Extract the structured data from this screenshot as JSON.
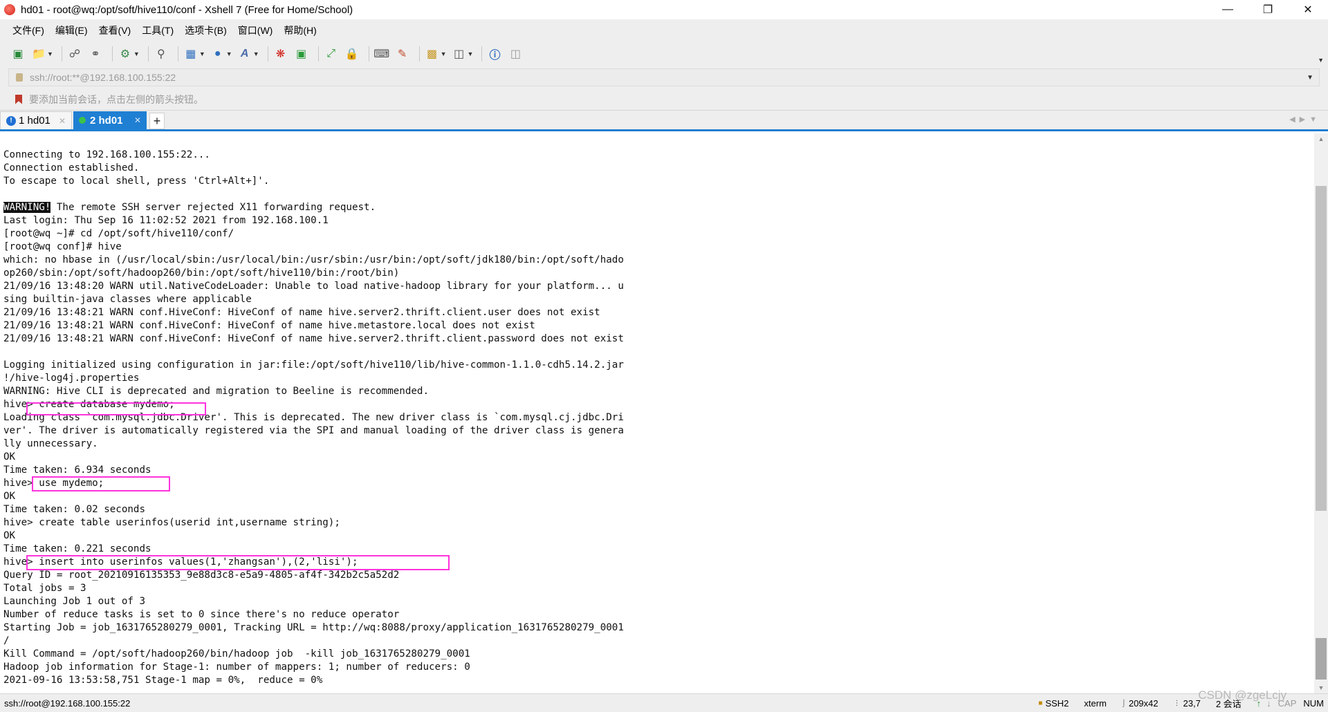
{
  "window": {
    "title": "hd01 - root@wq:/opt/soft/hive110/conf - Xshell 7 (Free for Home/School)",
    "minimize_icon": "minimize-icon",
    "maximize_icon": "restore-icon",
    "close_icon": "close-icon"
  },
  "menu": [
    "文件(F)",
    "编辑(E)",
    "查看(V)",
    "工具(T)",
    "选项卡(B)",
    "窗口(W)",
    "帮助(H)"
  ],
  "address": {
    "value": "ssh://root:**@192.168.100.155:22"
  },
  "hint": {
    "text": "要添加当前会话，点击左侧的箭头按钮。"
  },
  "tabs": [
    {
      "number": "1",
      "label": "hd01",
      "badge": "!"
    },
    {
      "number": "2",
      "label": "hd01"
    }
  ],
  "terminal": {
    "lines": [
      "Connecting to 192.168.100.155:22...",
      "Connection established.",
      "To escape to local shell, press 'Ctrl+Alt+]'.",
      "",
      "The remote SSH server rejected X11 forwarding request.",
      "Last login: Thu Sep 16 11:02:52 2021 from 192.168.100.1",
      "[root@wq ~]# cd /opt/soft/hive110/conf/",
      "[root@wq conf]# hive",
      "which: no hbase in (/usr/local/sbin:/usr/local/bin:/usr/sbin:/usr/bin:/opt/soft/jdk180/bin:/opt/soft/hado",
      "op260/sbin:/opt/soft/hadoop260/bin:/opt/soft/hive110/bin:/root/bin)",
      "21/09/16 13:48:20 WARN util.NativeCodeLoader: Unable to load native-hadoop library for your platform... u",
      "sing builtin-java classes where applicable",
      "21/09/16 13:48:21 WARN conf.HiveConf: HiveConf of name hive.server2.thrift.client.user does not exist",
      "21/09/16 13:48:21 WARN conf.HiveConf: HiveConf of name hive.metastore.local does not exist",
      "21/09/16 13:48:21 WARN conf.HiveConf: HiveConf of name hive.server2.thrift.client.password does not exist",
      "",
      "Logging initialized using configuration in jar:file:/opt/soft/hive110/lib/hive-common-1.1.0-cdh5.14.2.jar",
      "!/hive-log4j.properties",
      "WARNING: Hive CLI is deprecated and migration to Beeline is recommended.",
      "hive> create database mydemo;",
      "Loading class `com.mysql.jdbc.Driver'. This is deprecated. The new driver class is `com.mysql.cj.jdbc.Dri",
      "ver'. The driver is automatically registered via the SPI and manual loading of the driver class is genera",
      "lly unnecessary.",
      "OK",
      "Time taken: 6.934 seconds",
      "hive> use mydemo;",
      "OK",
      "Time taken: 0.02 seconds",
      "hive> create table userinfos(userid int,username string);",
      "OK",
      "Time taken: 0.221 seconds",
      "hive> insert into userinfos values(1,'zhangsan'),(2,'lisi');",
      "Query ID = root_20210916135353_9e88d3c8-e5a9-4805-af4f-342b2c5a52d2",
      "Total jobs = 3",
      "Launching Job 1 out of 3",
      "Number of reduce tasks is set to 0 since there's no reduce operator",
      "Starting Job = job_1631765280279_0001, Tracking URL = http://wq:8088/proxy/application_1631765280279_0001",
      "/",
      "Kill Command = /opt/soft/hadoop260/bin/hadoop job  -kill job_1631765280279_0001",
      "Hadoop job information for Stage-1: number of mappers: 1; number of reducers: 0",
      "2021-09-16 13:53:58,751 Stage-1 map = 0%,  reduce = 0%"
    ],
    "warning_tag": "WARNING!",
    "highlight_color": "#ff33dd"
  },
  "status": {
    "connection": "ssh://root@192.168.100.155:22",
    "protocol": "SSH2",
    "terminal": "xterm",
    "size": "209x42",
    "cursor": "23,7",
    "sessions": "2 会话",
    "caps": "CAP",
    "num": "NUM"
  },
  "watermark": "CSDN @zgeLcjy",
  "colors": {
    "accent": "#1f7fd3",
    "highlight": "#ff33dd"
  }
}
